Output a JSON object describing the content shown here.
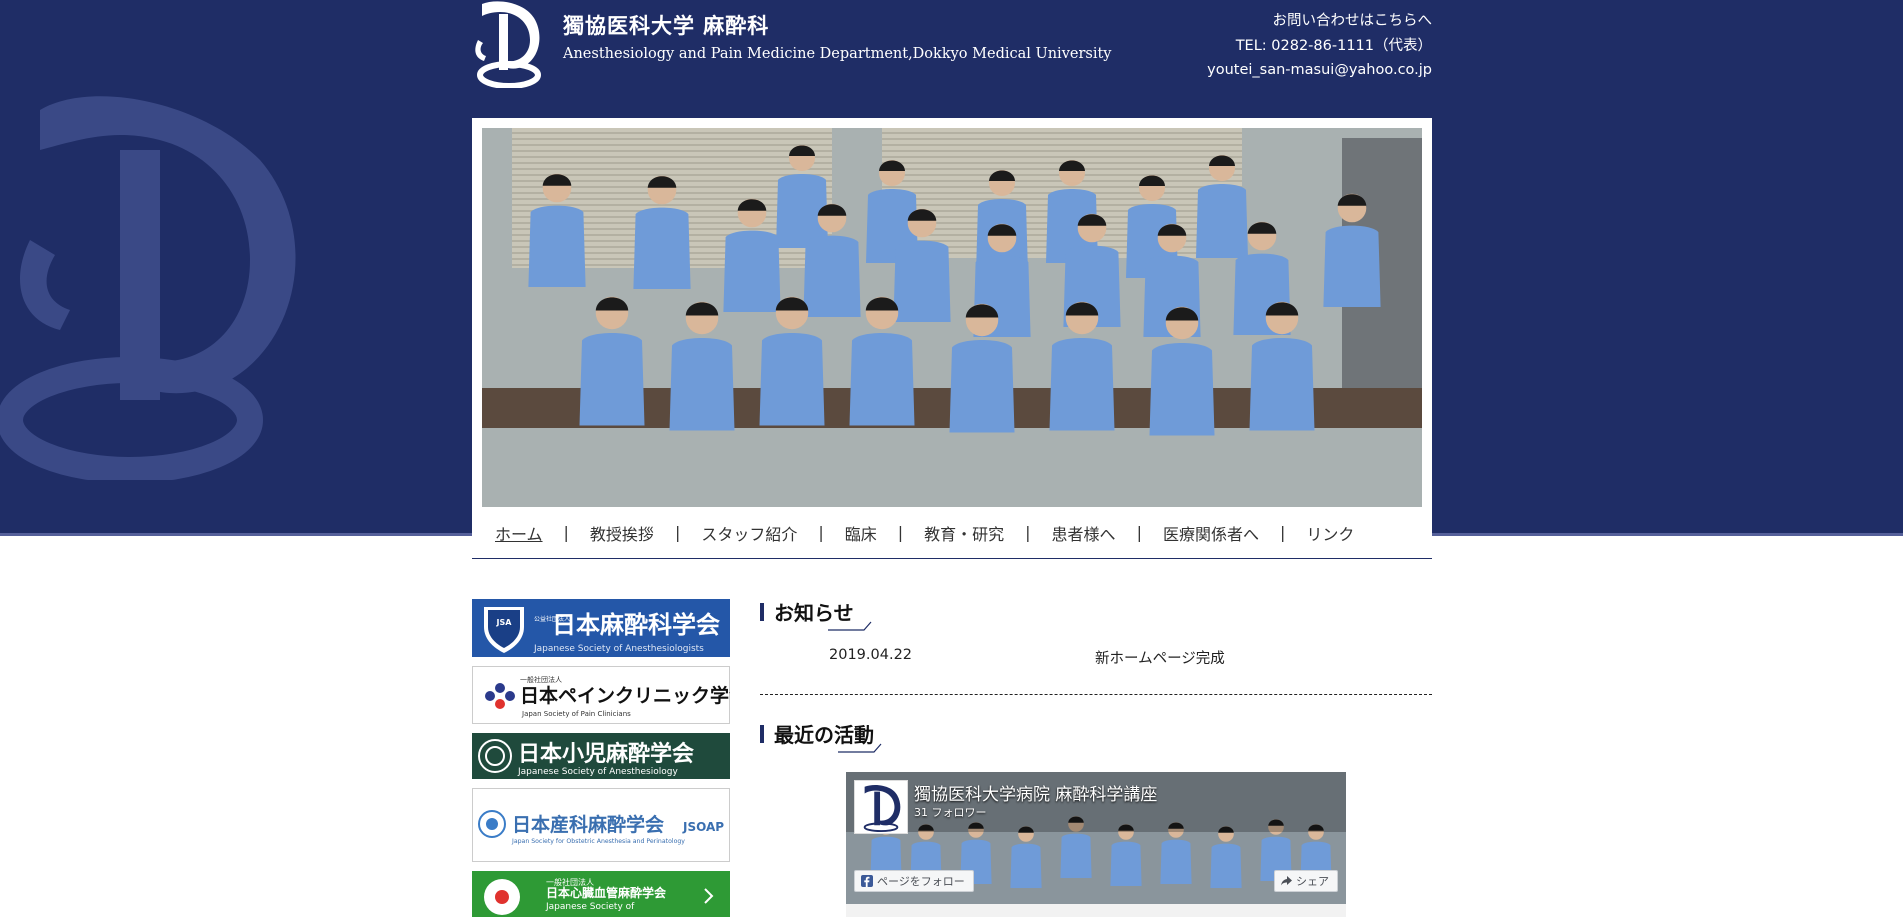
{
  "header": {
    "title": "獨協医科大学 麻酔科",
    "subtitle": "Anesthesiology and Pain Medicine Department,Dokkyo Medical University"
  },
  "contact": {
    "line1": "お問い合わせはこちらへ",
    "line2": "TEL: 0282-86-1111（代表）",
    "line3": "youtei_san-masui@yahoo.co.jp"
  },
  "nav": {
    "items": [
      {
        "label": "ホーム",
        "active": true
      },
      {
        "label": "教授挨拶"
      },
      {
        "label": "スタッフ紹介"
      },
      {
        "label": "臨床"
      },
      {
        "label": "教育・研究"
      },
      {
        "label": "患者様へ"
      },
      {
        "label": "医療関係者へ"
      },
      {
        "label": "リンク"
      }
    ],
    "separator": "|"
  },
  "sidebar": {
    "banners": [
      {
        "main": "日本麻酔科学会",
        "small": "Japanese Society of Anesthesiologists",
        "prefix": "公益社団法人",
        "badge": "JSA"
      },
      {
        "main": "日本ペインクリニック学会",
        "small": "Japan Society of Pain Clinicians",
        "prefix": "一般社団法人"
      },
      {
        "main": "日本小児麻酔学会",
        "small": "Japanese Society of Anesthesiology"
      },
      {
        "main": "日本産科麻酔学会",
        "suffix": "JSOAP",
        "small": "Japan Society for Obstetric Anesthesia and Perinatology"
      },
      {
        "prefix": "一般社団法人",
        "main": "日本心臓血管麻酔学会",
        "small": "Japanese Society of"
      }
    ]
  },
  "news": {
    "title": "お知らせ",
    "items": [
      {
        "date": "2019.04.22",
        "text": "新ホームページ完成"
      }
    ]
  },
  "recent": {
    "title": "最近の活動",
    "facebook": {
      "page_name": "獨協医科大学病院 麻酔科学講座",
      "followers": "31 フォロワー",
      "follow_label": "ページをフォロー",
      "share_label": "シェア"
    }
  },
  "colors": {
    "brand_navy": "#1f2d66",
    "scrub_blue": "#6f9bd8",
    "jsa_blue": "#2457a8",
    "pediatric_green": "#1f4a3c",
    "cardio_green": "#2e9a35"
  }
}
